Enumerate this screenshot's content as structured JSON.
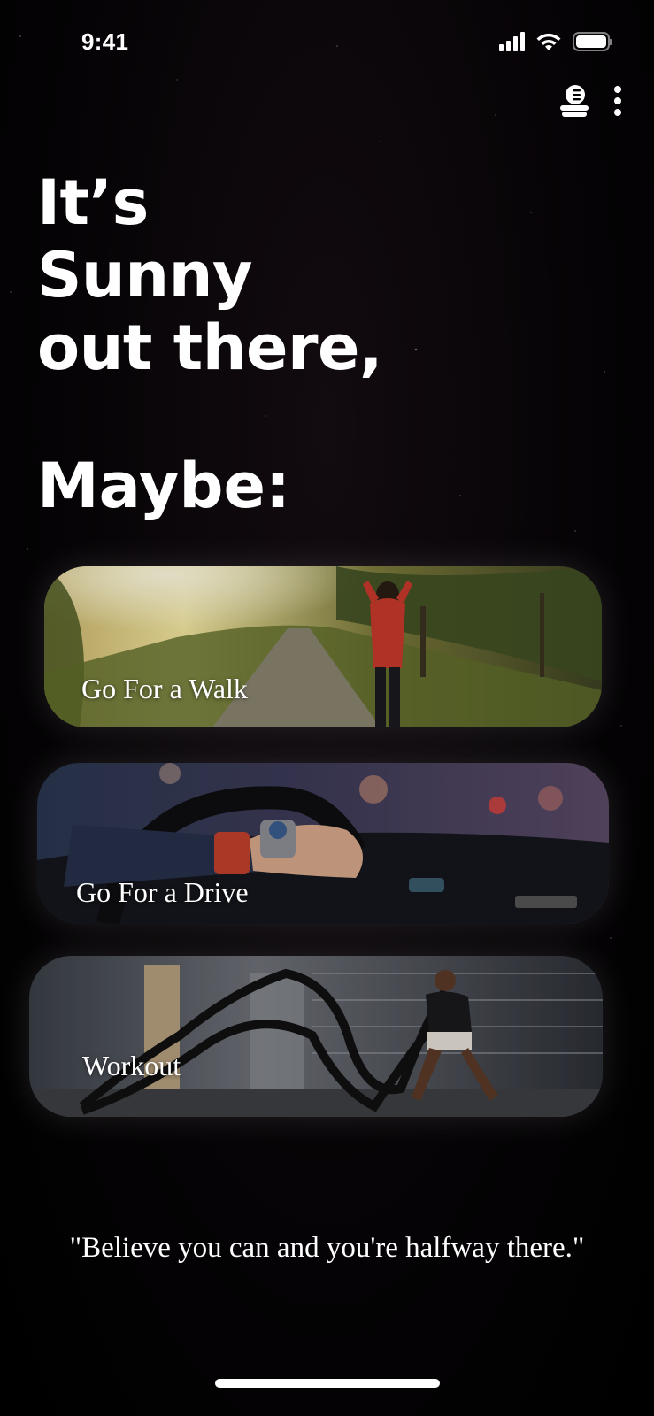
{
  "status_bar": {
    "time": "9:41",
    "icons": [
      "signal-icon",
      "wifi-icon",
      "battery-icon"
    ]
  },
  "top_actions": {
    "icons": [
      "coin-stack-icon",
      "more-vertical-icon"
    ]
  },
  "headline": {
    "line1": "It’s",
    "line2": "Sunny",
    "line3": "out there,"
  },
  "subhead": "Maybe:",
  "activities": [
    {
      "label": "Go For a Walk",
      "image": "woman-walking-on-country-road"
    },
    {
      "label": "Go For a Drive",
      "image": "hand-on-steering-wheel"
    },
    {
      "label": "Workout",
      "image": "man-with-battle-ropes"
    }
  ],
  "quote": "\"Believe you can and you're halfway there.\"",
  "colors": {
    "background": "#000000",
    "text": "#ffffff"
  }
}
